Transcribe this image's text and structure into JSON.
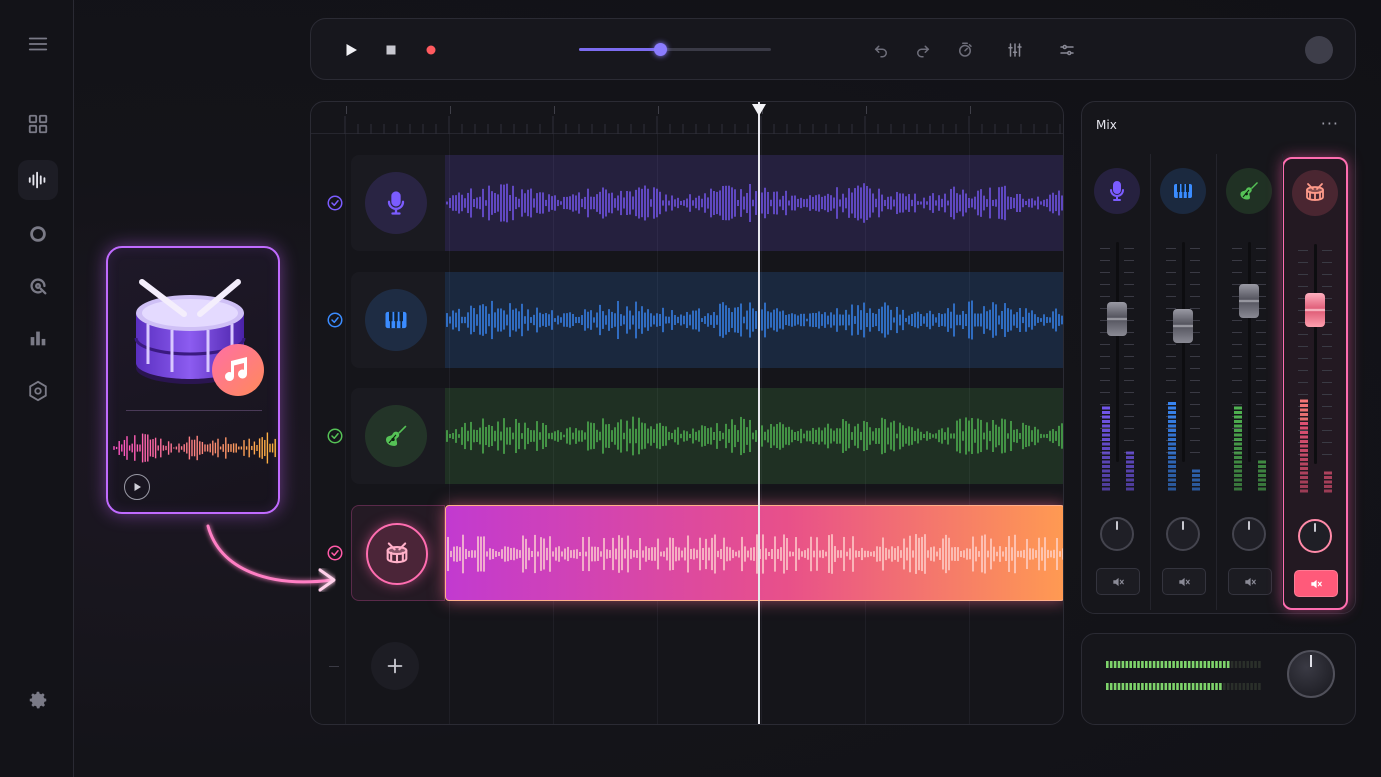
{
  "app": {
    "sidebar": {
      "items": [
        {
          "name": "menu-icon"
        },
        {
          "name": "grid-icon"
        },
        {
          "name": "waveform-icon",
          "active": true
        },
        {
          "name": "disc-icon"
        },
        {
          "name": "search-wave-icon"
        },
        {
          "name": "bar-chart-icon"
        },
        {
          "name": "hexagon-icon"
        },
        {
          "name": "settings-icon"
        }
      ]
    },
    "transport": {
      "buttons": [
        "play-icon",
        "stop-icon",
        "record-icon",
        "undo-icon",
        "redo-icon",
        "metronome-icon",
        "mixer-sliders-icon",
        "eq-sliders-icon"
      ],
      "position": 0.42,
      "record_color": "#ff5a5f"
    },
    "tracks": [
      {
        "name": "vocals",
        "icon": "microphone-icon",
        "color": "#7b5cff",
        "armed": true
      },
      {
        "name": "keys",
        "icon": "piano-icon",
        "color": "#3b8cff",
        "armed": true
      },
      {
        "name": "guitar",
        "icon": "guitar-icon",
        "color": "#55c256",
        "armed": true
      },
      {
        "name": "drums",
        "icon": "drum-icon",
        "color": "#ff5aa8",
        "armed": true,
        "selected": true
      }
    ],
    "mixer": {
      "title": "Mix",
      "more": "···",
      "channels": [
        {
          "icon": "microphone-icon",
          "color": "#7b5cff",
          "fader": 0.35,
          "meter": [
            0.82,
            0.38
          ]
        },
        {
          "icon": "piano-icon",
          "color": "#3b8cff",
          "fader": 0.38,
          "meter": [
            0.88,
            0.22
          ]
        },
        {
          "icon": "guitar-icon",
          "color": "#55c256",
          "fader": 0.27,
          "meter": [
            0.85,
            0.28
          ]
        },
        {
          "icon": "drum-icon",
          "color": "#ff6a8a",
          "fader": 0.3,
          "meter": [
            0.92,
            0.2
          ],
          "muted": true
        }
      ]
    },
    "master": {
      "meter_left": 0.78,
      "meter_right": 0.74
    },
    "drum_card": {
      "icon": "music-note-icon",
      "accent": "#c06bff"
    }
  }
}
